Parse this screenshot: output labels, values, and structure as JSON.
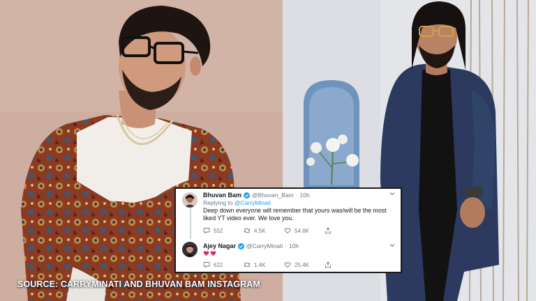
{
  "caption": {
    "source": "SOURCE: CARRYMINATI AND BHUVAN BAM INSTAGRAM"
  },
  "photos": {
    "left": {
      "subject": "man-with-glasses-patterned-jacket"
    },
    "right": {
      "subject": "man-with-glasses-dark-suit"
    }
  },
  "tweets": [
    {
      "name": "Bhuvan Bam",
      "handle": "@Bhuvan_Bam",
      "time": "10h",
      "replying_prefix": "Replying to",
      "replying_to": "@CarryMinati",
      "text": "Deep down everyone will remember that yours was/will be the most liked YT video ever. We love you.",
      "reply_count": "552",
      "retweet_count": "4.5K",
      "like_count": "54.6K"
    },
    {
      "name": "Ajey Nagar",
      "handle": "@CarryMinati",
      "time": "10h",
      "reply_count": "622",
      "retweet_count": "1.4K",
      "like_count": "25.4K",
      "emoji": "red-hearts"
    }
  ],
  "colors": {
    "verified": "#1da1f2",
    "icon": "#657786",
    "heart": "#e0245e"
  }
}
